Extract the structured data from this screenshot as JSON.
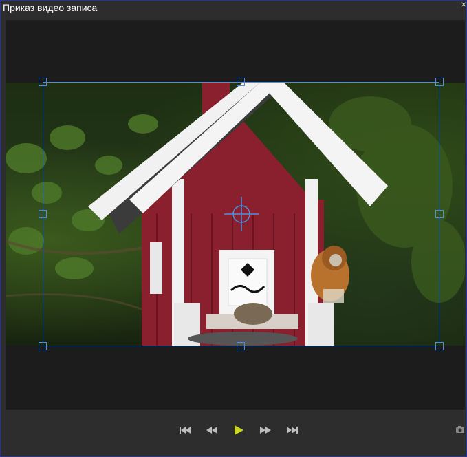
{
  "window": {
    "title": "Приказ видео записа"
  },
  "colors": {
    "accent": "#4a90e2",
    "play": "#c8d820",
    "controls_icon": "#bdbdbd"
  },
  "controls": {
    "buttons": [
      "skip-to-start-icon",
      "rewind-icon",
      "play-icon",
      "fast-forward-icon",
      "skip-to-end-icon"
    ]
  }
}
